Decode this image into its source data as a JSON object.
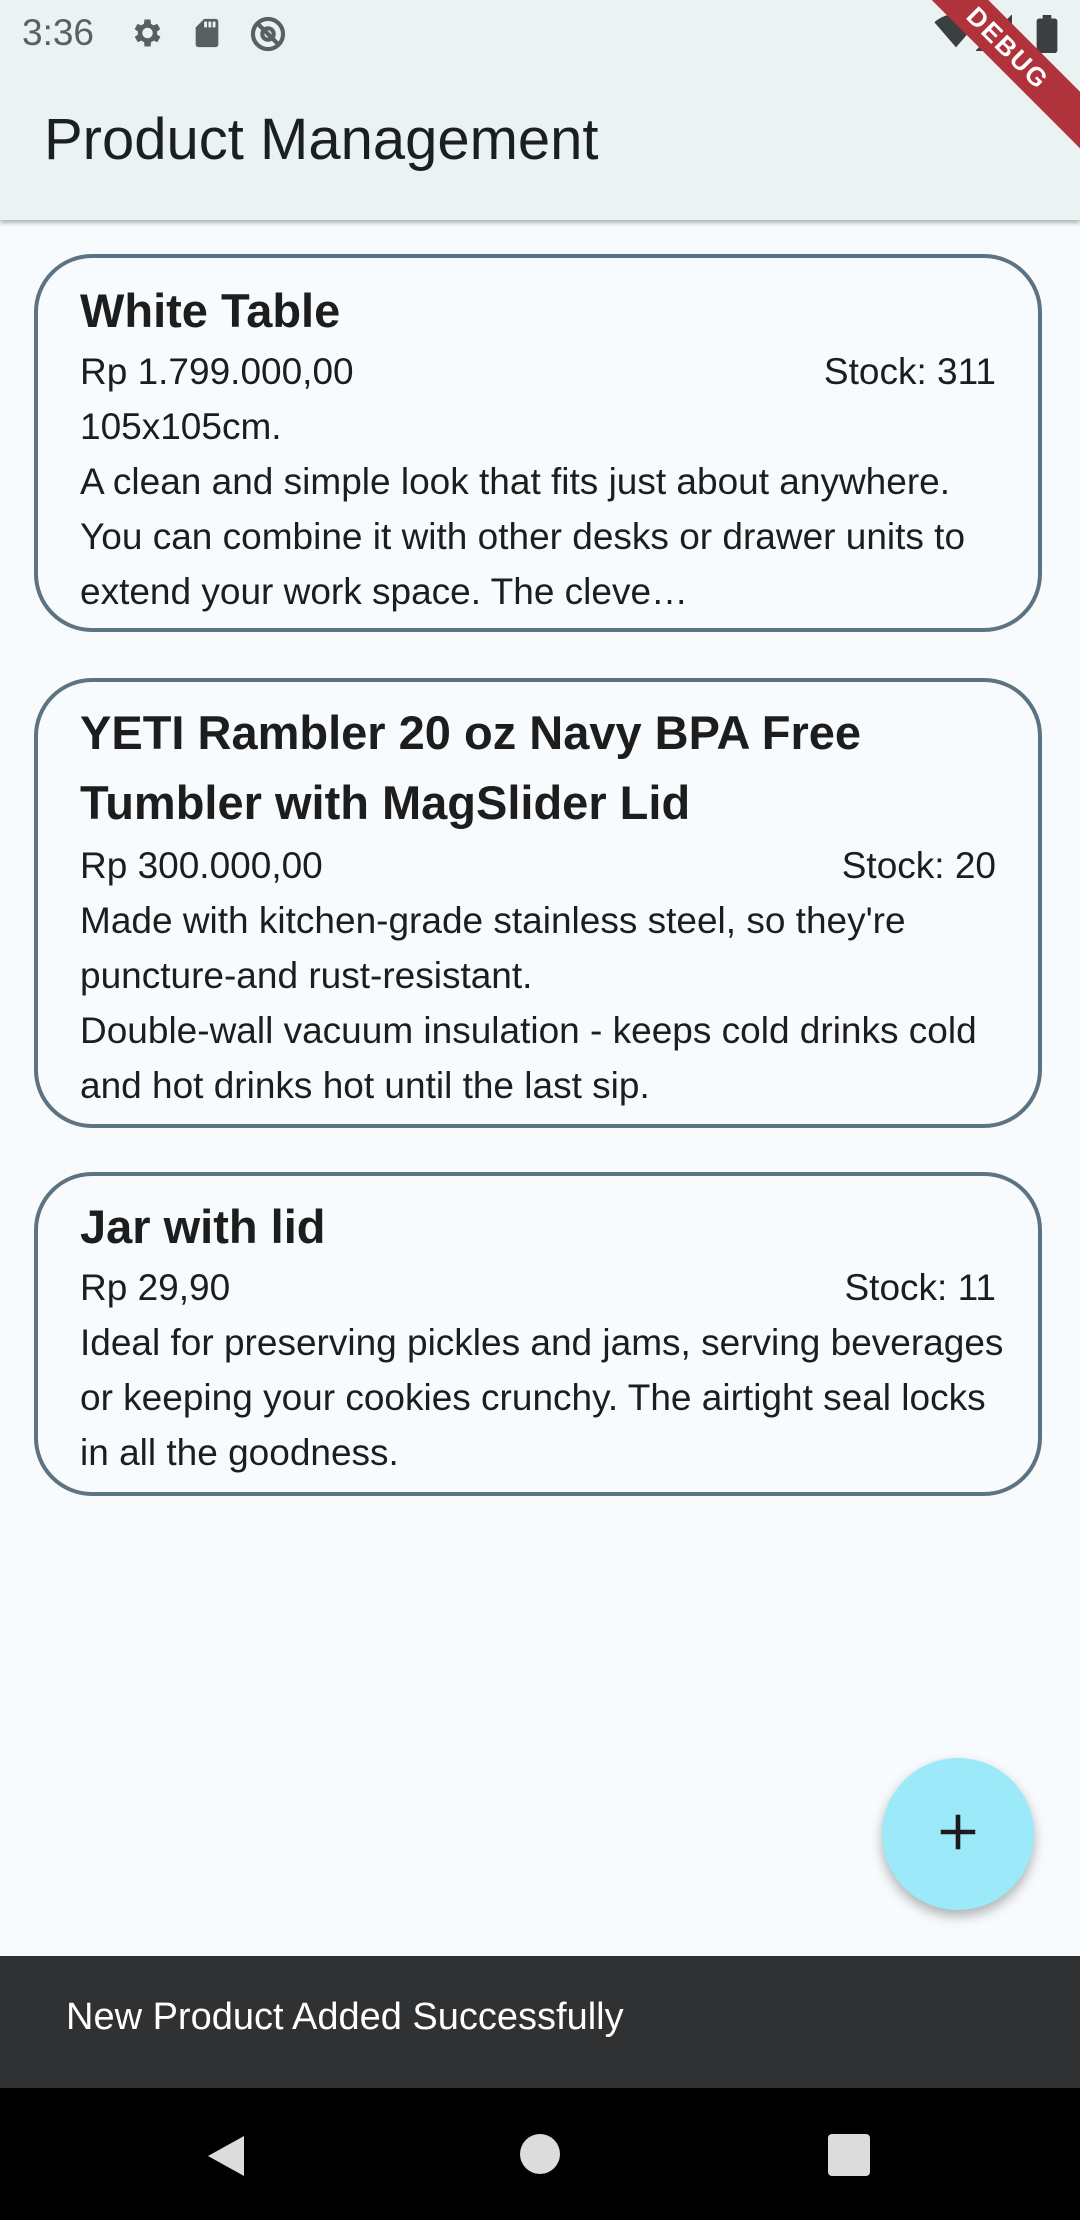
{
  "status_bar": {
    "time": "3:36",
    "left_icons": [
      "gear-icon",
      "sd-card-icon",
      "at-sign-icon"
    ],
    "right_icons": [
      "wifi-icon",
      "signal-icon",
      "battery-icon"
    ]
  },
  "debug_banner": "DEBUG",
  "app_bar": {
    "title": "Product Management"
  },
  "products": [
    {
      "name": "White Table",
      "price": "Rp 1.799.000,00",
      "stock": "Stock: 311",
      "description": "105x105cm.\nA clean and simple look that fits just about anywhere. You can combine it with other desks or drawer units to extend your work space. The cleve…"
    },
    {
      "name": "YETI Rambler 20 oz Navy BPA Free Tumbler with MagSlider Lid",
      "price": "Rp 300.000,00",
      "stock": "Stock: 20",
      "description": "Made with kitchen-grade stainless steel, so they're puncture-and rust-resistant.\nDouble-wall vacuum insulation - keeps cold drinks cold and hot drinks hot until the last sip."
    },
    {
      "name": "Jar with lid",
      "price": "Rp 29,90",
      "stock": "Stock: 11",
      "description": "Ideal for preserving pickles and jams, serving beverages or keeping your cookies crunchy. The airtight seal locks in all the goodness."
    }
  ],
  "fab": {
    "icon": "plus-icon"
  },
  "snackbar": {
    "message": "New Product Added Successfully"
  },
  "nav_bar": {
    "icons": [
      "back-icon",
      "home-icon",
      "recents-icon"
    ]
  },
  "colors": {
    "app_bar_bg": "#ebf2f3",
    "card_border": "#5d7381",
    "fab_bg": "#9ce9f9",
    "snackbar_bg": "#2f3133",
    "debug_banner": "#b0323a"
  }
}
